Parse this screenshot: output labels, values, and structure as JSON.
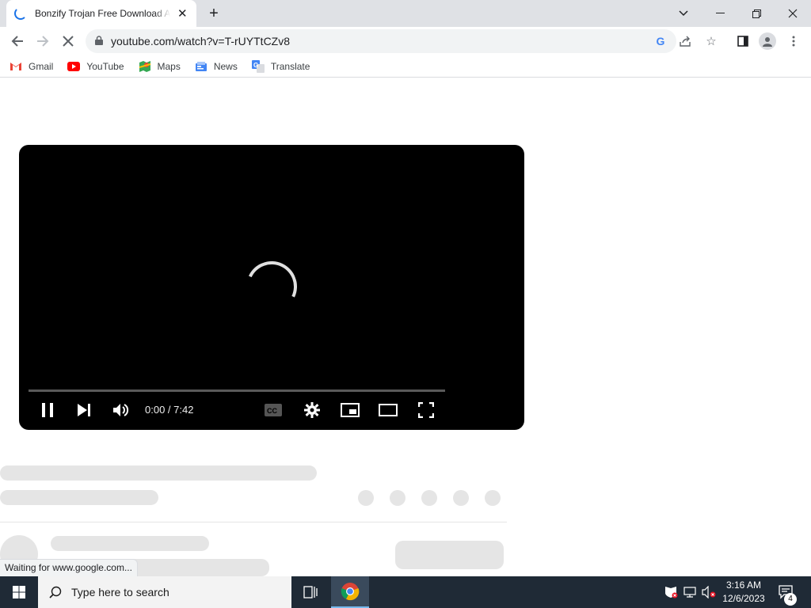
{
  "browser": {
    "tab_title": "Bonzify Trojan Free Download Al",
    "url": "youtube.com/watch?v=T-rUYTtCZv8",
    "bookmarks": [
      {
        "label": "Gmail",
        "icon": "gmail-icon"
      },
      {
        "label": "YouTube",
        "icon": "youtube-icon"
      },
      {
        "label": "Maps",
        "icon": "maps-icon"
      },
      {
        "label": "News",
        "icon": "news-icon"
      },
      {
        "label": "Translate",
        "icon": "translate-icon"
      }
    ],
    "status_text": "Waiting for www.google.com..."
  },
  "player": {
    "time_display": "0:00 / 7:42",
    "progress": 0
  },
  "taskbar": {
    "search_placeholder": "Type here to search",
    "clock_time": "3:16 AM",
    "clock_date": "12/6/2023",
    "notification_count": "4"
  },
  "colors": {
    "tabbar_bg": "#dfe1e5",
    "player_bg": "#000000",
    "taskbar_bg": "#1f2a36",
    "accent": "#1a73e8"
  }
}
